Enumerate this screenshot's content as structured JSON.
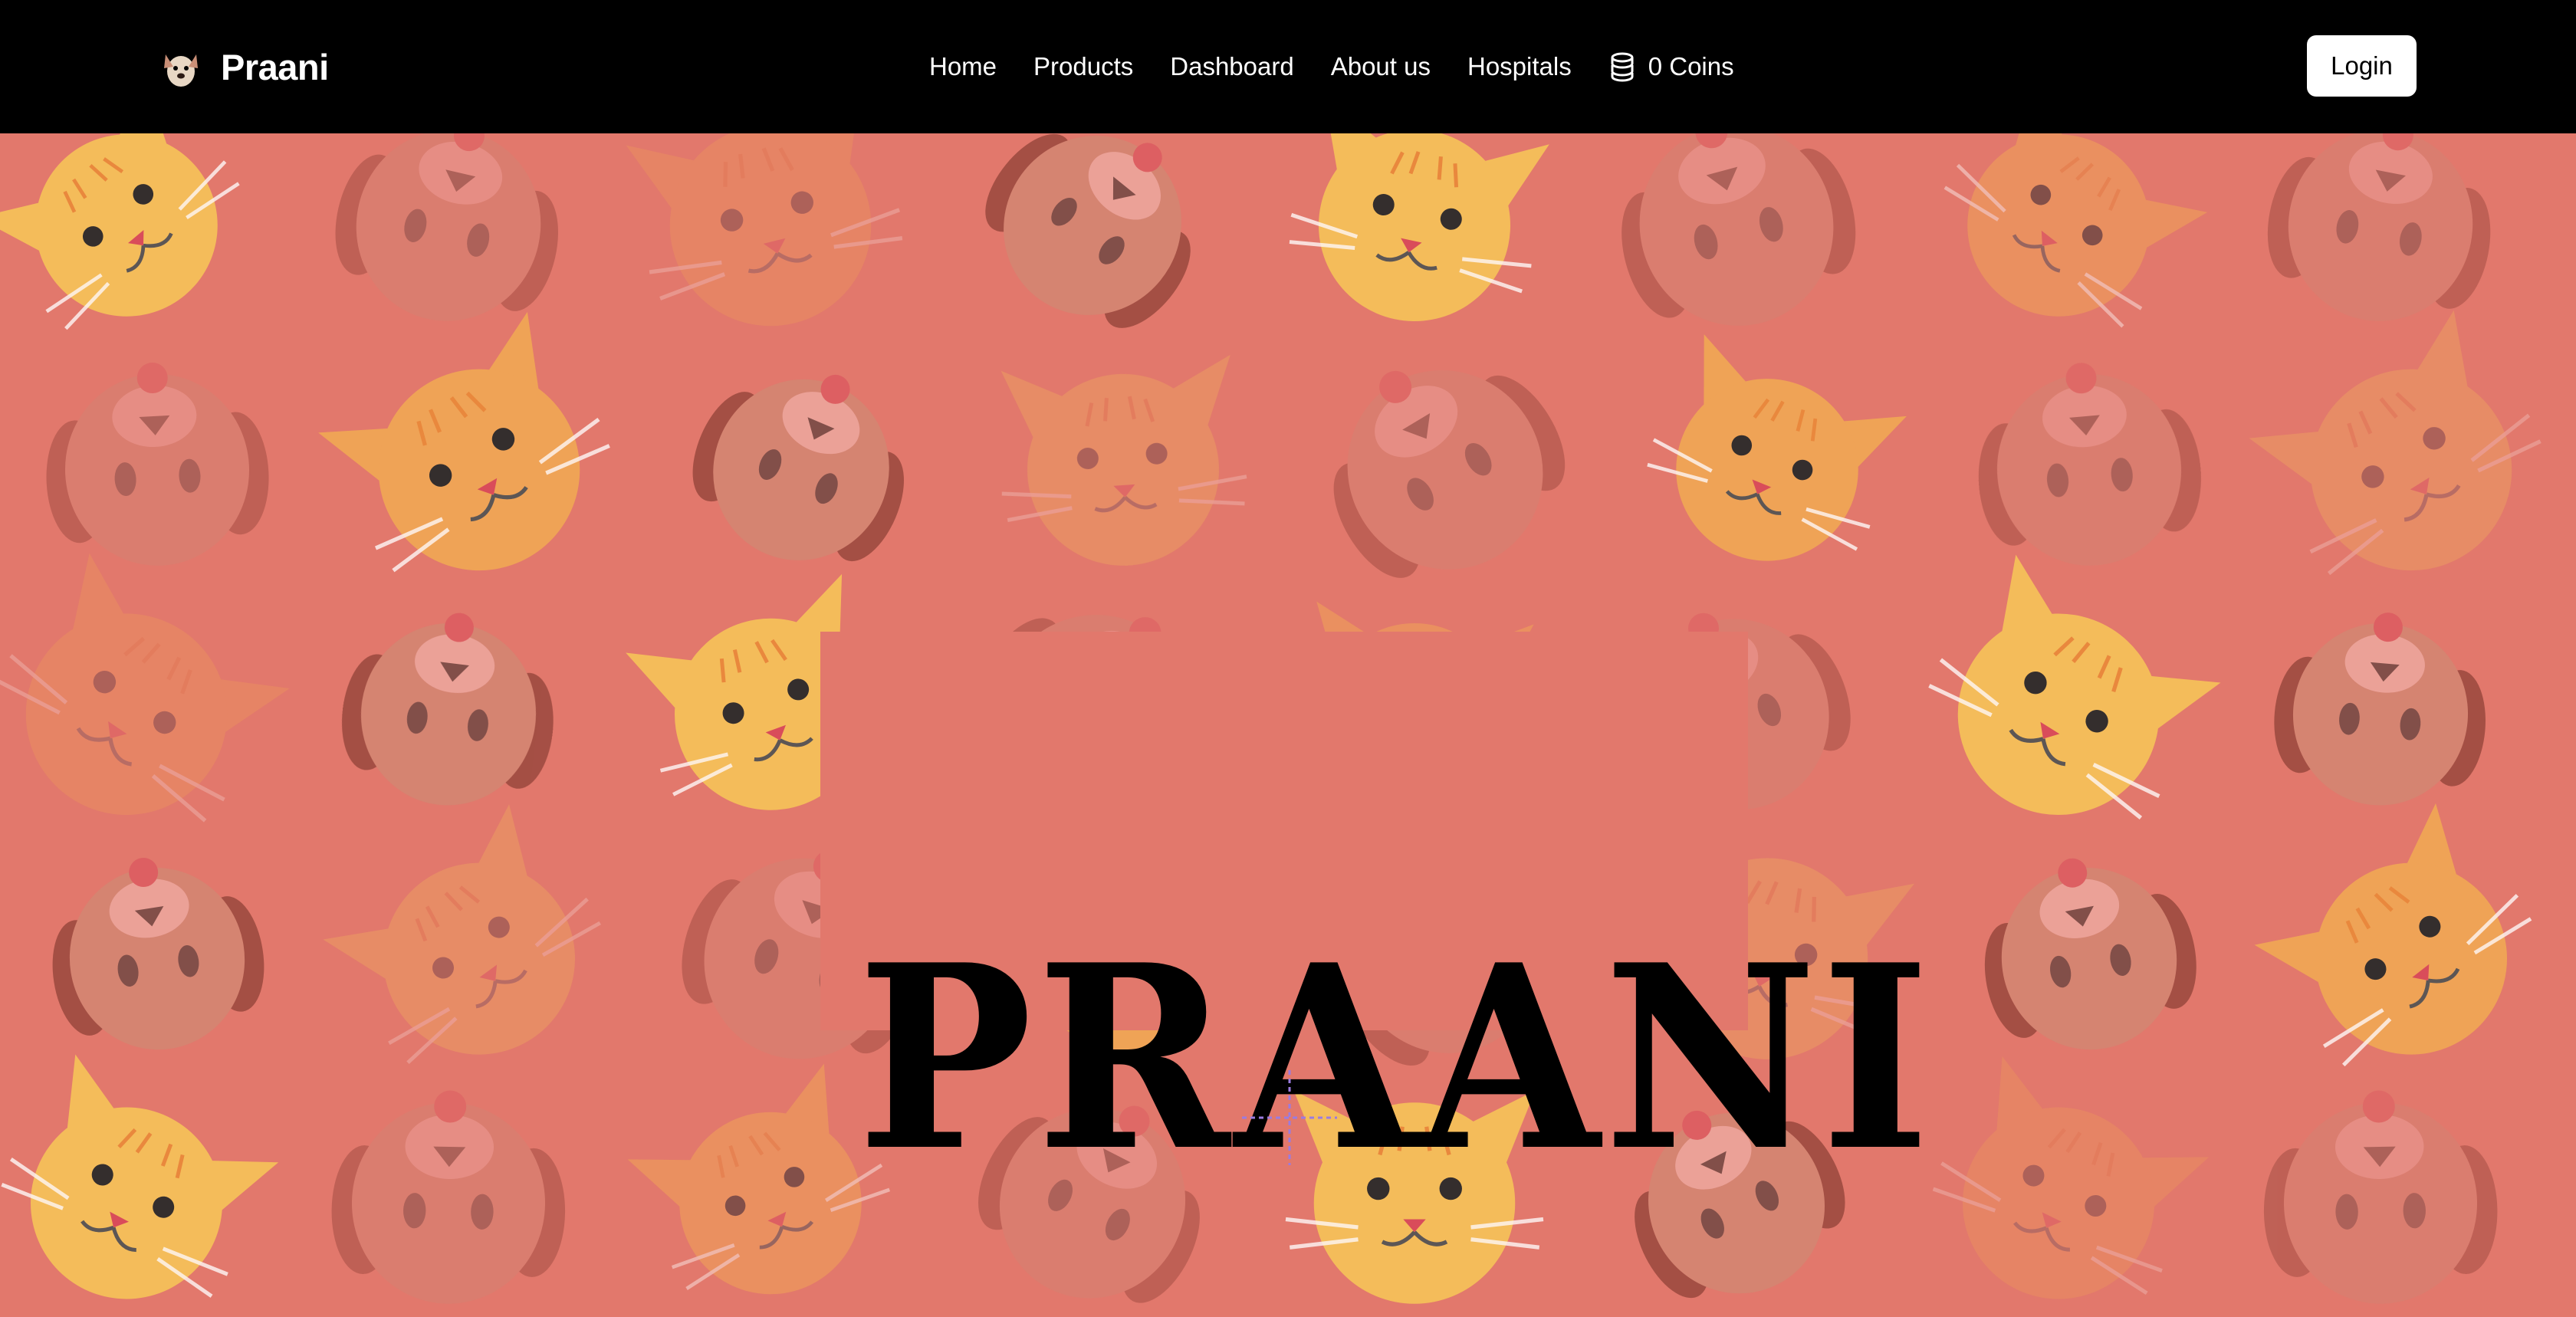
{
  "navbar": {
    "brand": "Praani",
    "links": [
      "Home",
      "Products",
      "Dashboard",
      "About us",
      "Hospitals"
    ],
    "coins_label": "0 Coins",
    "login_label": "Login"
  },
  "hero": {
    "title": "PRAANI"
  },
  "colors": {
    "nav_bg": "#000000",
    "hero_bg": "#E2786C",
    "cat_yellow": "#F5C05A",
    "cat_orange": "#F0A656",
    "dog_tan": "#C98F77",
    "dog_ear": "#6B2A20"
  },
  "icons": [
    "dog-logo-icon",
    "coins-icon",
    "cat-face-icon",
    "dog-face-icon",
    "crosshair-cursor-icon"
  ]
}
